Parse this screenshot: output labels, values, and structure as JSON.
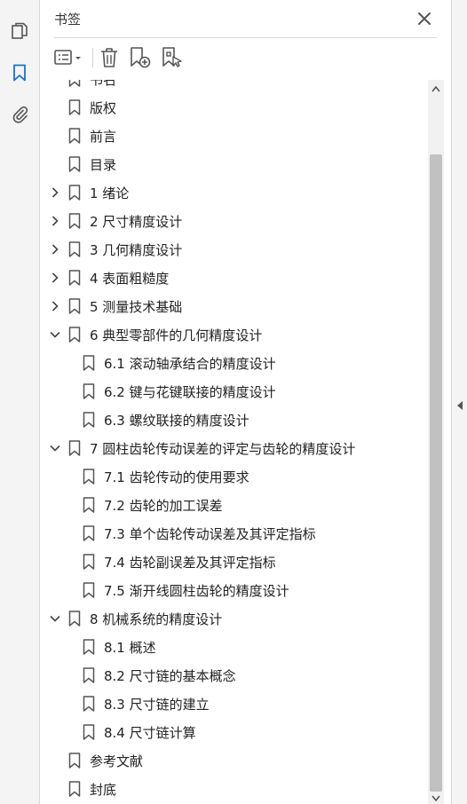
{
  "panel": {
    "title": "书签"
  },
  "leftbar": {
    "icons": [
      "pages-icon",
      "bookmark-icon",
      "attachment-icon"
    ],
    "active": "bookmark-icon",
    "accent": "#1a6fd6"
  },
  "toolbar": {
    "buttons": [
      "options-menu",
      "delete-bookmark",
      "new-bookmark",
      "new-bookmark-from-structure"
    ]
  },
  "bookmarks": [
    {
      "label": "书名",
      "level": 0,
      "expandable": false
    },
    {
      "label": "版权",
      "level": 0,
      "expandable": false
    },
    {
      "label": "前言",
      "level": 0,
      "expandable": false
    },
    {
      "label": "目录",
      "level": 0,
      "expandable": false
    },
    {
      "label": "1 绪论",
      "level": 0,
      "expandable": true,
      "expanded": false
    },
    {
      "label": "2 尺寸精度设计",
      "level": 0,
      "expandable": true,
      "expanded": false
    },
    {
      "label": "3 几何精度设计",
      "level": 0,
      "expandable": true,
      "expanded": false
    },
    {
      "label": "4 表面粗糙度",
      "level": 0,
      "expandable": true,
      "expanded": false
    },
    {
      "label": "5 测量技术基础",
      "level": 0,
      "expandable": true,
      "expanded": false
    },
    {
      "label": "6 典型零部件的几何精度设计",
      "level": 0,
      "expandable": true,
      "expanded": true
    },
    {
      "label": "6.1 滚动轴承结合的精度设计",
      "level": 1,
      "expandable": false
    },
    {
      "label": "6.2 键与花键联接的精度设计",
      "level": 1,
      "expandable": false
    },
    {
      "label": "6.3 螺纹联接的精度设计",
      "level": 1,
      "expandable": false
    },
    {
      "label": "7 圆柱齿轮传动误差的评定与齿轮的精度设计",
      "level": 0,
      "expandable": true,
      "expanded": true
    },
    {
      "label": "7.1 齿轮传动的使用要求",
      "level": 1,
      "expandable": false
    },
    {
      "label": "7.2 齿轮的加工误差",
      "level": 1,
      "expandable": false
    },
    {
      "label": "7.3 单个齿轮传动误差及其评定指标",
      "level": 1,
      "expandable": false
    },
    {
      "label": "7.4 齿轮副误差及其评定指标",
      "level": 1,
      "expandable": false
    },
    {
      "label": "7.5 渐开线圆柱齿轮的精度设计",
      "level": 1,
      "expandable": false
    },
    {
      "label": "8 机械系统的精度设计",
      "level": 0,
      "expandable": true,
      "expanded": true
    },
    {
      "label": "8.1 概述",
      "level": 1,
      "expandable": false
    },
    {
      "label": "8.2 尺寸链的基本概念",
      "level": 1,
      "expandable": false
    },
    {
      "label": "8.3 尺寸链的建立",
      "level": 1,
      "expandable": false
    },
    {
      "label": "8.4 尺寸链计算",
      "level": 1,
      "expandable": false
    },
    {
      "label": "参考文献",
      "level": 0,
      "expandable": false
    },
    {
      "label": "封底",
      "level": 0,
      "expandable": false
    }
  ]
}
